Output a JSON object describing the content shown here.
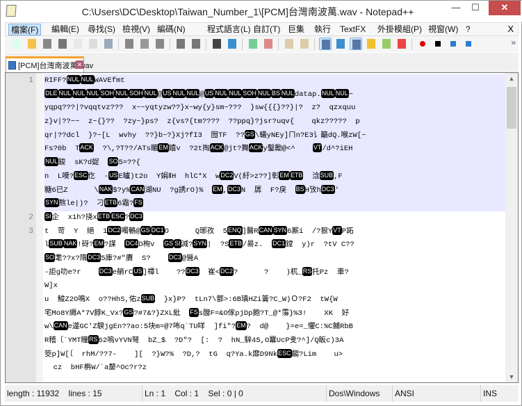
{
  "window": {
    "title": "C:\\Users\\DC\\Desktop\\Taiwan_Number_1\\[PCM]台灣南波萬.wav - Notepad++",
    "minimize": "—",
    "maximize": "☐",
    "close": "✕"
  },
  "menu": {
    "items": [
      "檔案(F)",
      "編輯(E)",
      "尋找(S)",
      "檢視(V)",
      "編碼(N)",
      "程式語言(L)",
      "自訂(T)",
      "巨集",
      "執行",
      "TextFX",
      "外掛模組(P)",
      "視窗(W)",
      "?"
    ],
    "close": "X"
  },
  "toolbar": {
    "buttons": [
      "new-file",
      "open-file",
      "save",
      "save-all",
      "close",
      "close-all",
      "print",
      "cut",
      "copy",
      "paste",
      "undo",
      "redo",
      "find",
      "replace",
      "zoom-in",
      "zoom-out",
      "sync-vertical",
      "sync-horizontal",
      "word-wrap",
      "show-all-chars",
      "indent-guide",
      "user-defined-language",
      "doc-map",
      "function-list",
      "record-macro",
      "stop-record",
      "play-macro",
      "run-macro-multiple"
    ],
    "active": [
      "word-wrap",
      "indent-guide"
    ],
    "more": "»"
  },
  "tab": {
    "label": "[PCM]台灣南波萬.wav",
    "close": "✕"
  },
  "editor": {
    "current_line_color": "#e8e8ff",
    "lines": [
      {
        "number": "1",
        "rows": [
          "RIFF?«NUL»«NUL»WAVEfmt ",
          "«DLE»«NUL»«NUL»«NUL»«SOH»«NUL»«SOH»«NUL»@«US»«NUL»«NUL»@«US»«NUL»«NUL»«SOH»«NUL»«BS»«NUL»datap.«NUL»«NUL»~",
          "yqpq???|?vqqtvz???  x~~yqtyzw??}x~wy{y}sm~???  }sw{{{}??}|?  z?  qzxquu",
          "z}v|??~~  z~{}??  ?zy~}ps?  z{vs?{tm????  ??ppq}?jsr?uqv{    qkz?????  p",
          "qr|??dcl  }?~[L  wvhy  ??}b~?}Xj?fI3  囫TF  ??«GS»\\蟻yNEy]ㄇn?E3讠籲dQ.喉zW[~",
          "Fs?0b  T«ACK»  ?\\,?T??/ATs睸«EM»嬉v  ?2t掏«ACK»@jt?舞«ACK»y鑿勵@<^    «VT»/d^?iEH",
          "«NUL»鋑  sK?d娖  «SO»5=??{",
          "n  L嗼?«ESC»仡  -«US»E曥)t2o  Y娟ⅡH  hlC*X  w«DC2»V(紆>z??]彰«EM»«ETB»  浛«SUB»,F",
          "糖6已Z      \\«NAK»$?y%«CAN»湖NU  ?g誘rO)%  «EM»,«DC3»N  孱  F?戾  «BS»H攷h«DC3»'",
          "«SYN»熬le|)?  刁«ETB»6霜?«FS»"
        ]
      },
      {
        "number": "2",
        "rows": [
          "«SI»企  x1h?挠x«ETB»«ESC»?«DC3»"
        ]
      },
      {
        "number": "3",
        "rows": [
          "t  苛  Y  絕  1«DC2»噣鵪@«GS»«DC1»O      Q琊孜  5«ENQ»]醫R«CAN»«SYN»6厮i  /?狠Y«VT»P跖",
          "l«SUB»«NAK»!砑?«EM»?謀  «DC4»D栒v  «GS»«SI»減?«SYN»|  ?S«ETB»/昜z.  «DC1»鏜  y)r  ?tV C??",
          "«SO»耄??x?隋«DC3»5庫?#\"賡  S?    «DC3»@聳A",
          "-詎g叻e?r    «DC3»e艄rC«US»]禫l    ??«DC3»  崔<«DC2»?      ?    )杌_«RS»托Pz  車?",
          "W]x",
          "u  鮻Z2O鳴X  o??HhS,佑z«SUB»  }x}P?  tLn7\\鄫>:6B瑱HZi籥?C_W)Ｏ?F2  tW{W",
          "宅Mo8Y縟A*7V餑K_Vx?«GS»?#7&?}ZXL紕  «FS»s醙F=&O傢pjDp飽?T_@*霶}%3!    XK  好",
          "w\\«CAN»e遾GC'Z騤jgEn??ao:5块m=@7咘q`TU咩  ]fi\"?«EM»?  d@    }=e=_懼C:%C餔RbB",
          "R稽〔`YMT瞳«RS»62嗚vYVN弩  bZ_$  ?D\"?  [:  ?  hN_騂45,O羃UcP叏?^]/Q眅c)3A",
          "筊p]W[〔  rhM/??7-    ][  ?}W?%  ?D,?  tG  q?Ya.k靡D9Nk«ESC»齺?Lim    u>",
          "  cz  bHF栴W/`a嫠^Oc?r?z"
        ]
      }
    ]
  },
  "status": {
    "length": "length : 11932",
    "lines": "lines : 15",
    "position": "Ln : 1    Col : 1    Sel : 0 | 0",
    "eol": "Dos\\Windows",
    "encoding": "ANSI",
    "mode": "INS"
  }
}
